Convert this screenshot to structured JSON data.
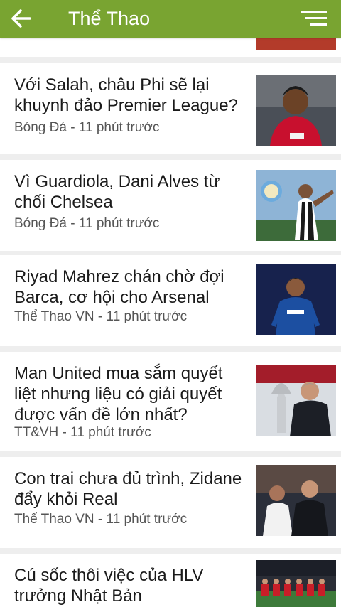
{
  "app_bar": {
    "title": "Thể Thao",
    "back_icon": "arrow-left-icon",
    "menu_icon": "sort-menu-icon",
    "color": "#79a431"
  },
  "articles": [
    {
      "title": "Với Salah, châu Phi sẽ lại khuynh đảo Premier League?",
      "source": "Bóng Đá",
      "time": "11 phút trước",
      "meta": "Bóng Đá - 11 phút trước"
    },
    {
      "title": "Vì Guardiola, Dani Alves từ chối Chelsea",
      "source": "Bóng Đá",
      "time": "11 phút trước",
      "meta": "Bóng Đá - 11 phút trước"
    },
    {
      "title": "Riyad Mahrez chán chờ đợi Barca, cơ hội cho Arsenal",
      "source": "Thể Thao VN",
      "time": "11 phút trước",
      "meta": "Thể Thao VN - 11 phút trước"
    },
    {
      "title": "Man United mua sắm quyết liệt nhưng liệu có giải quyết được vấn đề lớn nhất?",
      "source": "TT&VH",
      "time": "11 phút trước",
      "meta": "TT&VH - 11 phút trước"
    },
    {
      "title": "Con trai chưa đủ trình, Zidane đẩy khỏi Real",
      "source": "Thể Thao VN",
      "time": "11 phút trước",
      "meta": "Thể Thao VN - 11 phút trước"
    },
    {
      "title": "Cú sốc thôi việc của HLV trưởng Nhật Bản",
      "source": "",
      "time": "",
      "meta": ""
    }
  ]
}
